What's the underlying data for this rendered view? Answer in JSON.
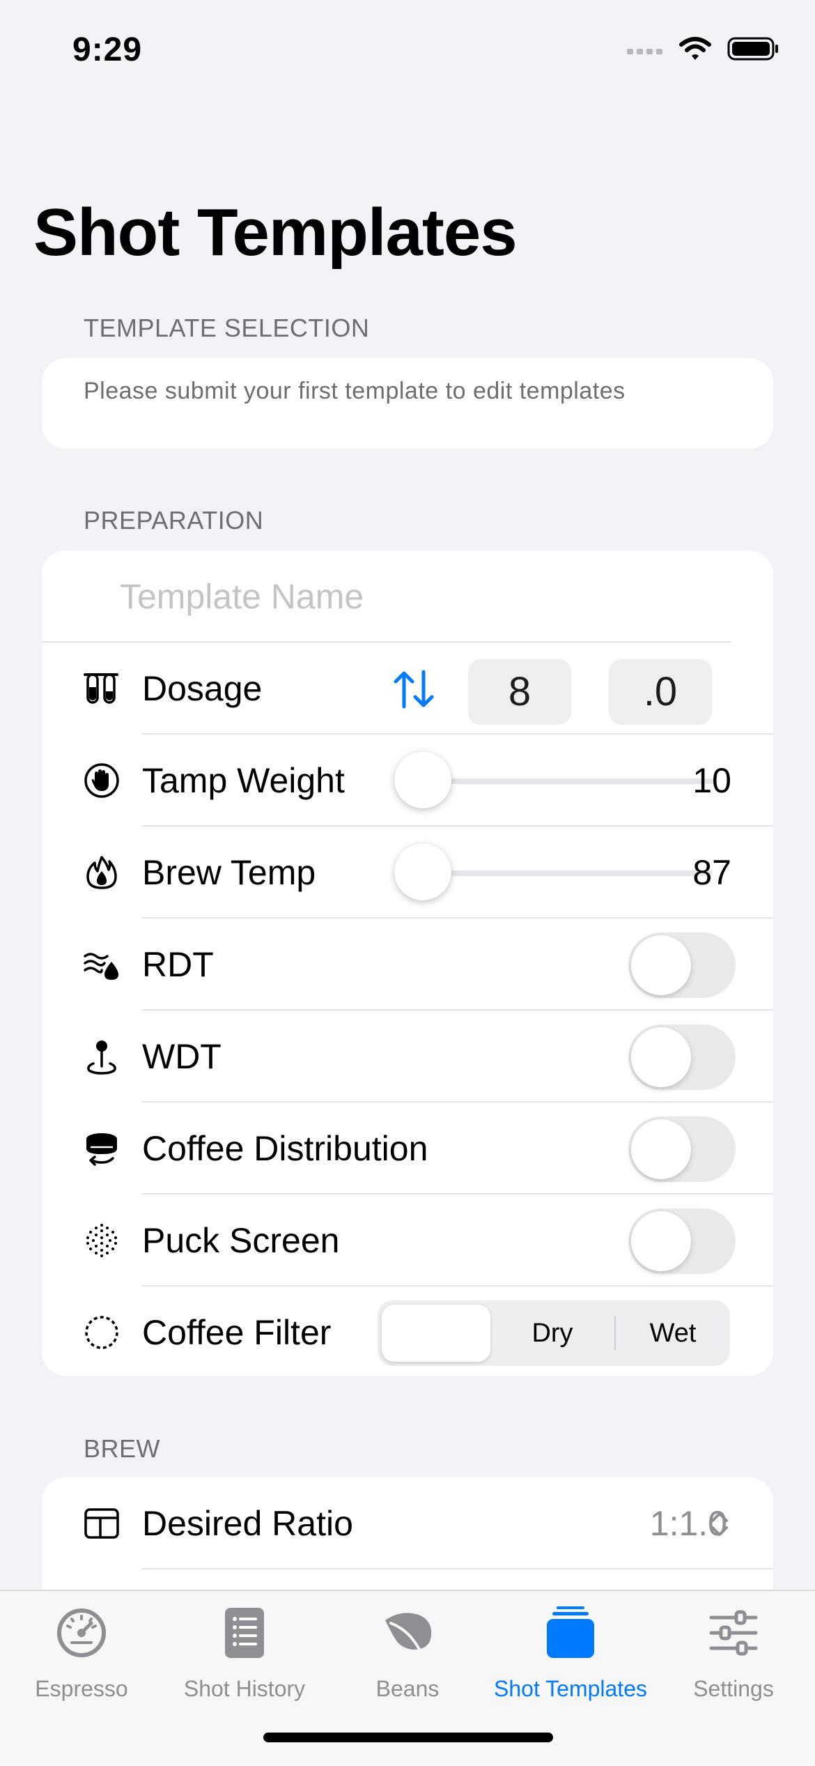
{
  "status_bar": {
    "time": "9:29"
  },
  "page": {
    "title": "Shot Templates"
  },
  "template_selection": {
    "header": "TEMPLATE SELECTION",
    "hint": "Please submit your first template to edit templates"
  },
  "preparation": {
    "header": "PREPARATION",
    "name_placeholder": "Template Name",
    "dosage": {
      "label": "Dosage",
      "whole": "8",
      "fraction": ".0"
    },
    "tamp_weight": {
      "label": "Tamp Weight",
      "value": "10"
    },
    "brew_temp": {
      "label": "Brew Temp",
      "value": "87"
    },
    "rdt": {
      "label": "RDT",
      "on": false
    },
    "wdt": {
      "label": "WDT",
      "on": false
    },
    "coffee_distribution": {
      "label": "Coffee Distribution",
      "on": false
    },
    "puck_screen": {
      "label": "Puck Screen",
      "on": false
    },
    "coffee_filter": {
      "label": "Coffee Filter",
      "options": [
        "",
        "Dry",
        "Wet"
      ],
      "selected_index": 0
    }
  },
  "brew": {
    "header": "BREW",
    "desired_ratio": {
      "label": "Desired Ratio",
      "value": "1:1.0"
    }
  },
  "tab_bar": {
    "tabs": [
      {
        "label": "Espresso",
        "icon": "gauge-icon"
      },
      {
        "label": "Shot History",
        "icon": "list-icon"
      },
      {
        "label": "Beans",
        "icon": "leaf-icon"
      },
      {
        "label": "Shot Templates",
        "icon": "stack-icon"
      },
      {
        "label": "Settings",
        "icon": "sliders-icon"
      }
    ],
    "active_index": 3
  },
  "colors": {
    "accent": "#007aff",
    "background": "#f2f2f7",
    "secondary_text": "#8e8e93"
  }
}
